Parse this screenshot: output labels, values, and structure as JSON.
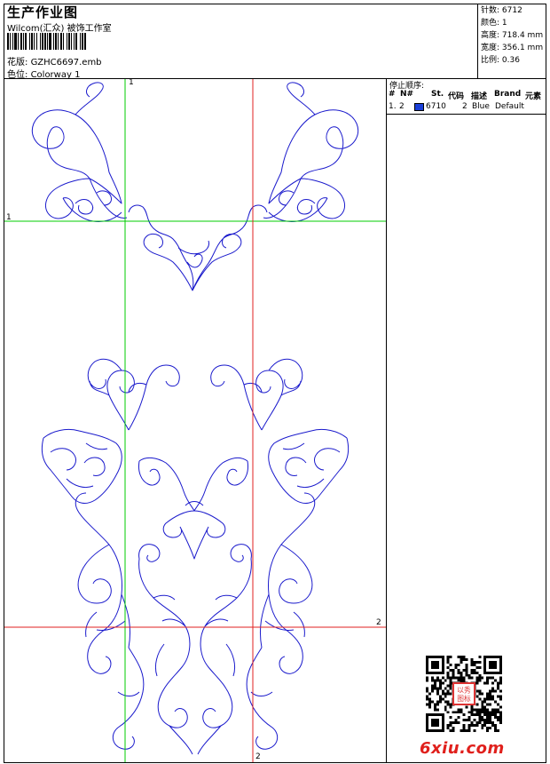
{
  "header": {
    "title": "生产作业图",
    "company": "Wilcom(汇众) 被饰工作室",
    "design_label": "花版:",
    "design_value": "GZHC6697.emb",
    "colorway_label": "色位:",
    "colorway_value": "Colorway 1"
  },
  "stats": [
    {
      "label": "针数:",
      "value": "6712"
    },
    {
      "label": "颜色:",
      "value": "1"
    },
    {
      "label": "高度:",
      "value": "718.4 mm"
    },
    {
      "label": "宽度:",
      "value": "356.1 mm"
    },
    {
      "label": "比例:",
      "value": "0.36"
    }
  ],
  "stop_sequence": {
    "title": "停止顺序:",
    "headers": [
      "#",
      "N#",
      "St.",
      "代码",
      "描述",
      "Brand",
      "元素"
    ],
    "rows": [
      {
        "index": "1.",
        "needle": "2",
        "stitches": "6710",
        "code": "2",
        "description": "Blue",
        "brand": "Default",
        "color": "#1a3fd8"
      }
    ]
  },
  "guides": {
    "green_label": "1",
    "red_label": "2",
    "green_color": "#00cc00",
    "red_color": "#e02020"
  },
  "design_color": "#1a1acc",
  "watermark": {
    "site": "6xiu.com",
    "seal_text": "以秀\n图标"
  }
}
